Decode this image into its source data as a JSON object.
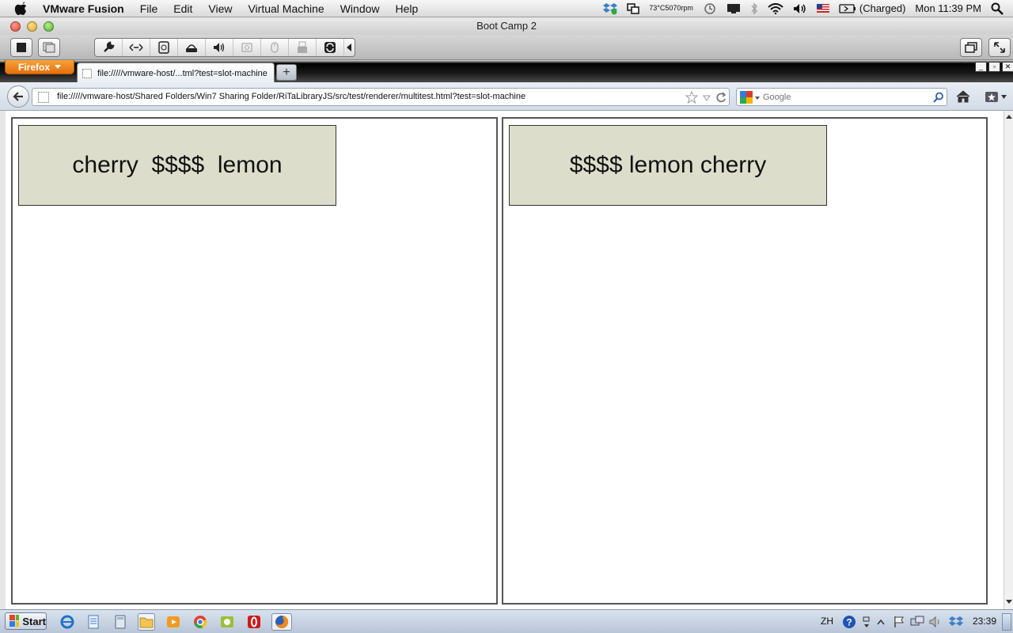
{
  "menubar": {
    "app_name": "VMware Fusion",
    "items": [
      "File",
      "Edit",
      "View",
      "Virtual Machine",
      "Window",
      "Help"
    ],
    "temp": "73°C",
    "fan": "5070rpm",
    "battery": "(Charged)",
    "clock": "Mon 11:39 PM"
  },
  "vm_window": {
    "title": "Boot Camp 2"
  },
  "firefox": {
    "menu_button": "Firefox",
    "tab_title": "file://///vmware-host/...tml?test=slot-machine",
    "new_tab_label": "+",
    "url": "file://///vmware-host/Shared Folders/Win7 Sharing Folder/RiTaLibraryJS/src/test/renderer/multitest.html?test=slot-machine",
    "search_placeholder": "Google"
  },
  "panes": [
    {
      "text": "cherry  $$$$  lemon"
    },
    {
      "text": "$$$$ lemon cherry"
    }
  ],
  "taskbar": {
    "start_label": "Start",
    "language": "ZH",
    "time": "23:39"
  },
  "colors": {
    "slot_box_bg": "#dcdecb",
    "firefox_orange": "#e4700e"
  }
}
